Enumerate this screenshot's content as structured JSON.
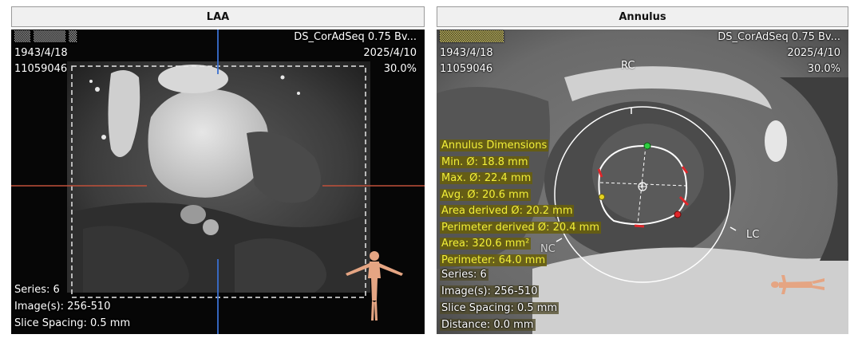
{
  "left_panel": {
    "title": "LAA",
    "overlay": {
      "patient_name": "▒▒ ▒▒▒▒ ▒",
      "series_description": "DS_CorAdSeq  0.75  Bv...",
      "birth_date": "1943/4/18",
      "study_date": "2025/4/10",
      "patient_id": "11059046",
      "zoom": "30.0%",
      "series": "Series: 6",
      "images": "Image(s): 256-510",
      "slice_spacing": "Slice Spacing: 0.5 mm"
    },
    "colors": {
      "crosshair_vertical": "#3a6fd0",
      "crosshair_horizontal": "#c0503a",
      "roi_dashes": "#e8e8e8"
    },
    "icons": {
      "orientation": "human-body-orientation-icon"
    }
  },
  "right_panel": {
    "title": "Annulus",
    "overlay": {
      "patient_name": "▒▒▒▒▒▒▒▒",
      "series_description": "DS_CorAdSeq  0.75  Bv...",
      "birth_date": "1943/4/18",
      "study_date": "2025/4/10",
      "patient_id": "11059046",
      "zoom": "30.0%",
      "series": "Series: 6",
      "images": "Image(s): 256-510",
      "slice_spacing": "Slice Spacing: 0.5 mm",
      "distance": "Distance: 0.0 mm"
    },
    "annulus_dimensions": {
      "title": "Annulus Dimensions",
      "min": "Min. Ø: 18.8 mm",
      "max": "Max. Ø: 22.4 mm",
      "avg": "Avg. Ø: 20.6 mm",
      "area_derived": "Area derived Ø: 20.2 mm",
      "perimeter_derived": "Perimeter derived Ø: 20.4 mm",
      "area": "Area: 320.6 mm²",
      "perimeter": "Perimeter: 64.0 mm"
    },
    "cusp_labels": {
      "rc": "RC",
      "lc": "LC",
      "nc": "NC"
    },
    "colors": {
      "measure_text": "#f2ef38",
      "annulus_outline": "#ffffff",
      "marker_red": "#e0262a",
      "marker_green": "#2ecc40",
      "marker_yellow": "#e6d320"
    },
    "icons": {
      "orientation": "human-body-lying-orientation-icon"
    }
  }
}
